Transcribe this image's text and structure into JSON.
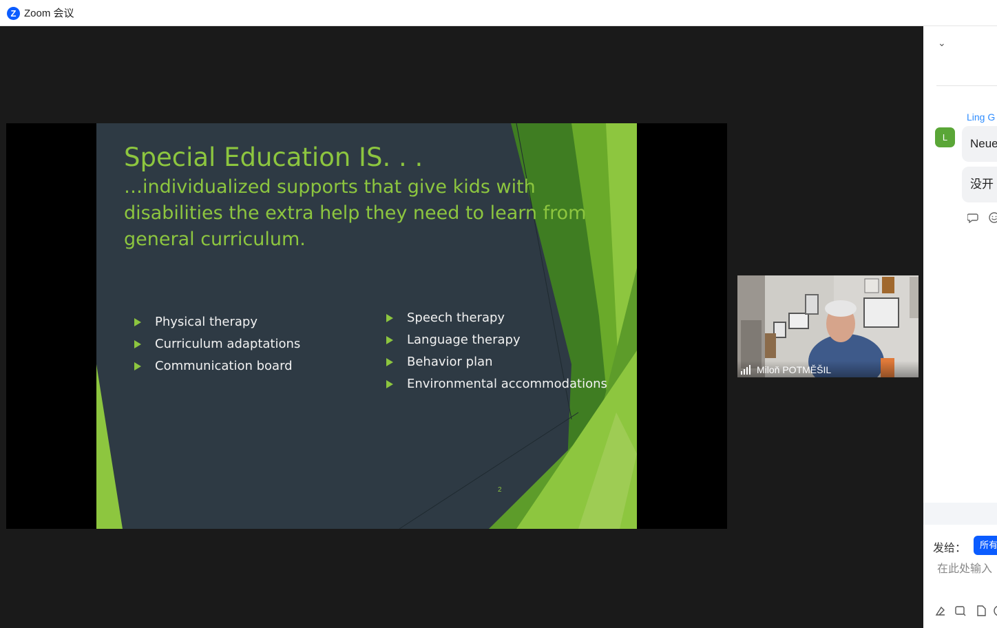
{
  "window": {
    "logo_letter": "Z",
    "title": "Zoom 会议"
  },
  "slide": {
    "title": "Special Education IS. . .",
    "subtitle": "…individualized supports that give kids with disabilities  the extra help they need to learn from general curriculum.",
    "left_bullets": [
      "Physical therapy",
      "Curriculum adaptations",
      "Communication board"
    ],
    "right_bullets": [
      "Speech therapy",
      "Language therapy",
      "Behavior plan",
      "Environmental accommodations"
    ],
    "page_number": "2",
    "colors": {
      "background": "#2e3a44",
      "accent": "#8dc63f"
    }
  },
  "participant": {
    "name": "Miloň POTMĚŠIL"
  },
  "chat": {
    "collapse_icon": "⌄",
    "sender_name": "Ling G",
    "sender_initial": "L",
    "messages": [
      "Neue",
      "没开"
    ],
    "reply_icon": "reply-icon",
    "react_icon": "emoji-icon",
    "send_to_label": "发给：",
    "recipient": "所有",
    "input_placeholder": "在此处输入",
    "tool_icons": [
      "format-icon",
      "screenshot-icon",
      "file-icon",
      "more-icon"
    ],
    "accent": "#0b5cff"
  }
}
